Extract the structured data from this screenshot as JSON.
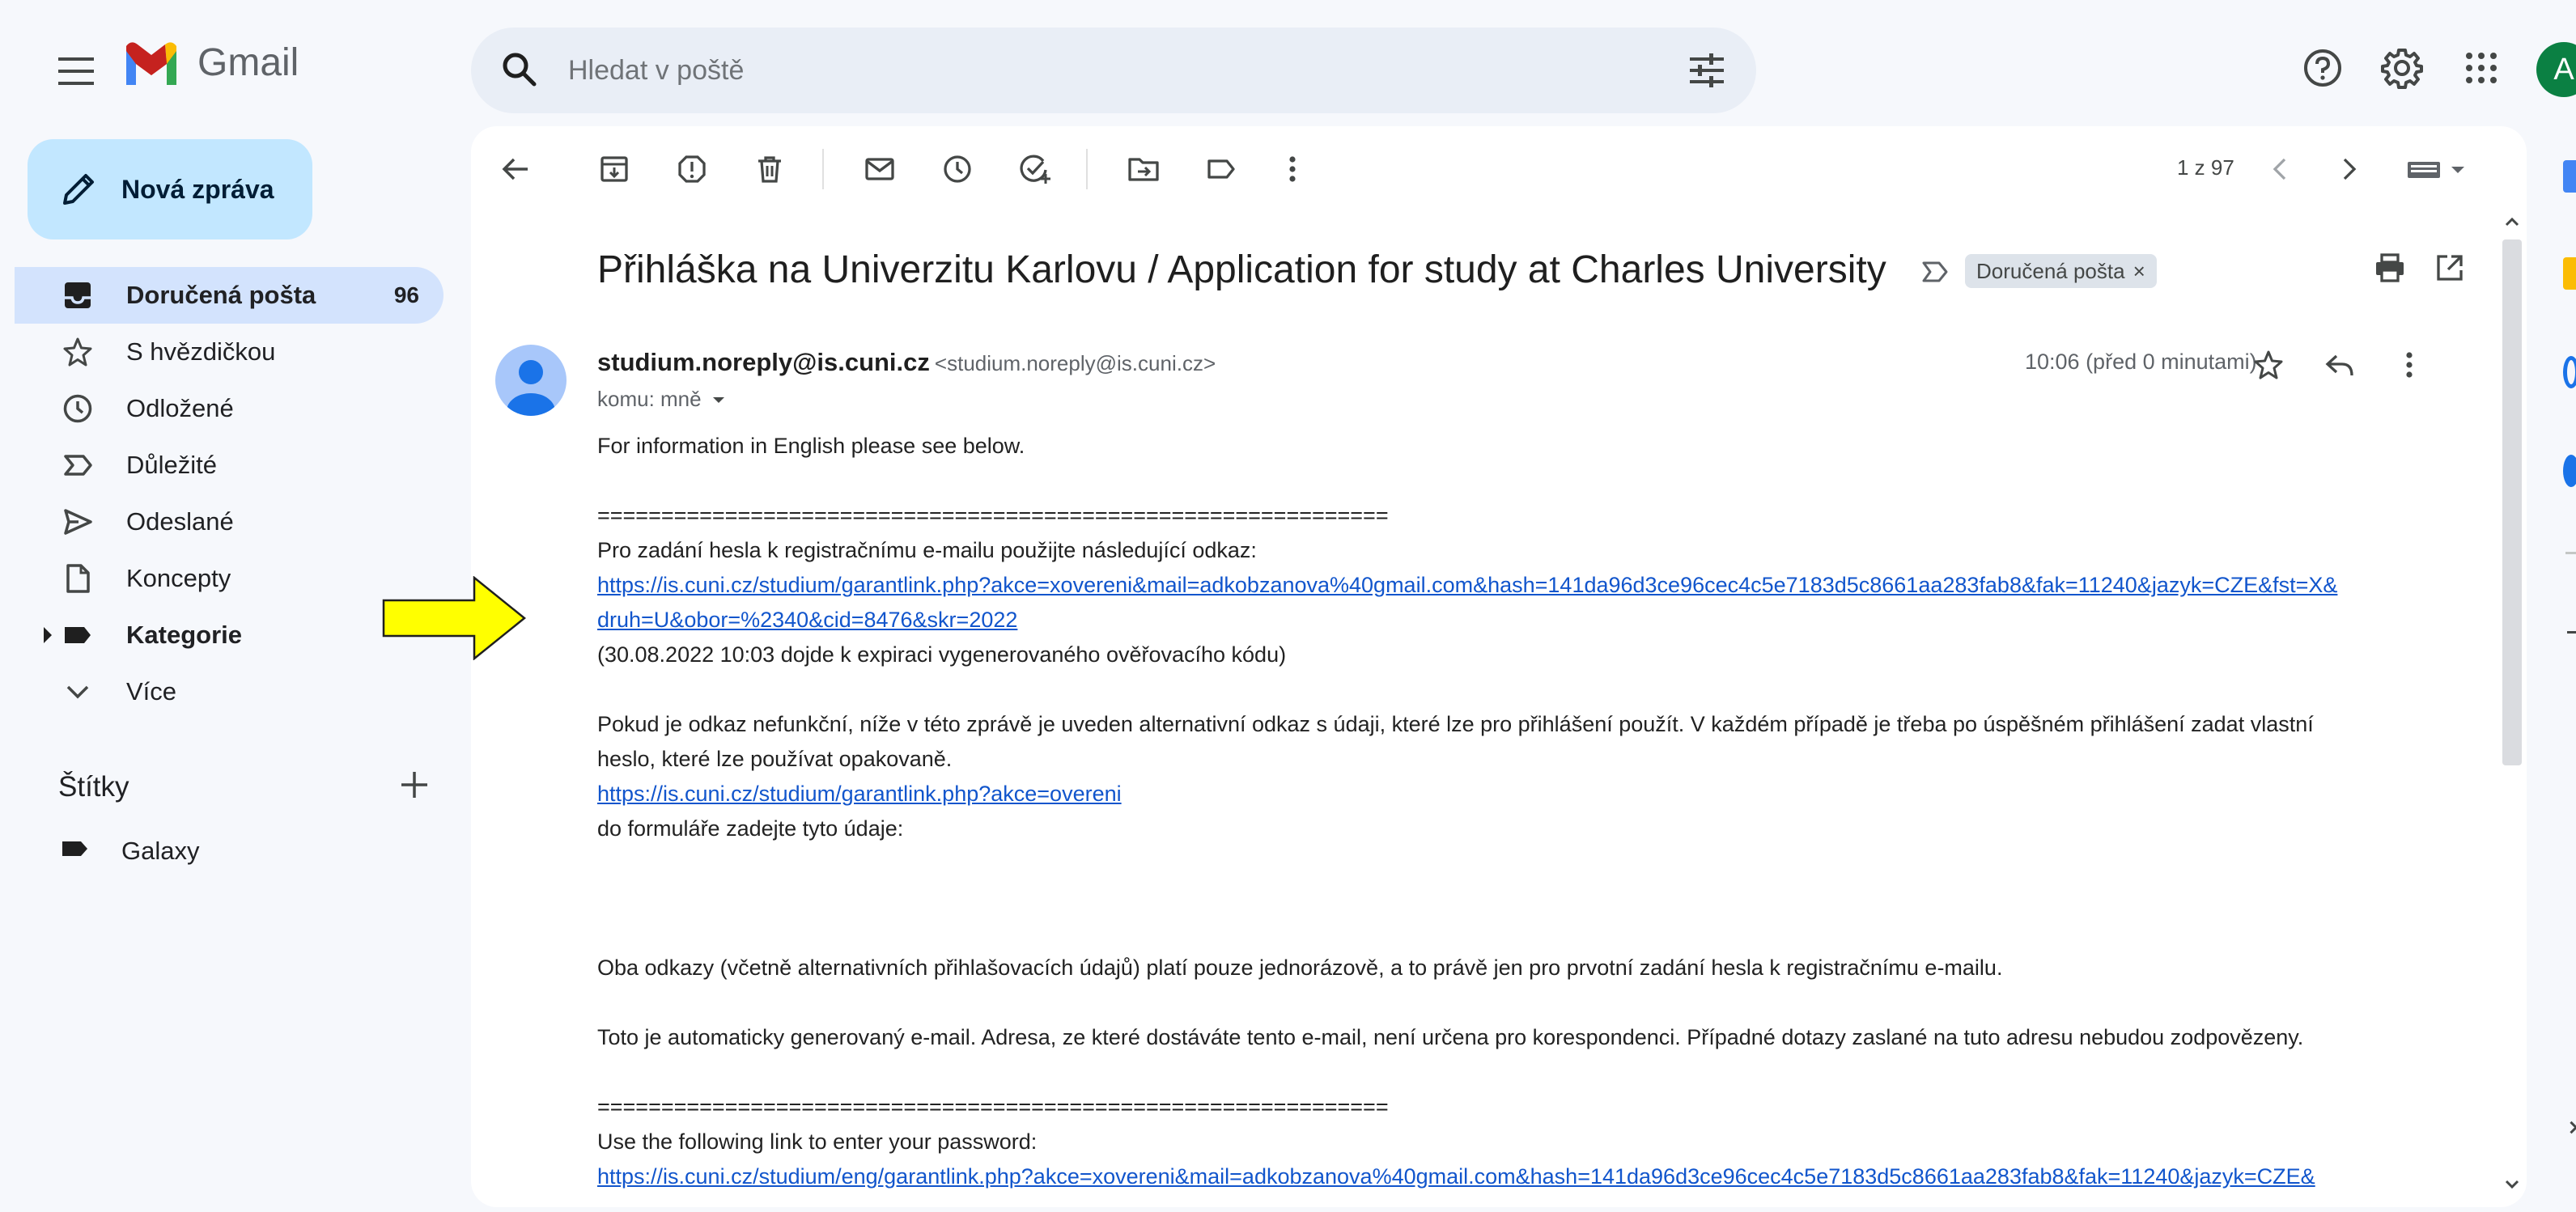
{
  "app": {
    "name": "Gmail"
  },
  "search": {
    "placeholder": "Hledat v poště"
  },
  "account": {
    "initial": "A"
  },
  "compose": {
    "label": "Nová zpráva"
  },
  "nav": {
    "items": [
      {
        "label": "Doručená pošta",
        "count": "96",
        "icon": "inbox-icon"
      },
      {
        "label": "S hvězdičkou",
        "icon": "star-icon"
      },
      {
        "label": "Odložené",
        "icon": "clock-icon"
      },
      {
        "label": "Důležité",
        "icon": "important-icon"
      },
      {
        "label": "Odeslané",
        "icon": "send-icon"
      },
      {
        "label": "Koncepty",
        "icon": "draft-icon"
      },
      {
        "label": "Kategorie",
        "icon": "label-icon"
      },
      {
        "label": "Více",
        "icon": "chevron-down-icon"
      }
    ]
  },
  "labels": {
    "title": "Štítky",
    "items": [
      {
        "label": "Galaxy"
      }
    ]
  },
  "toolbar": {
    "pager": "1 z 97"
  },
  "message": {
    "subject": "Přihláška na Univerzitu Karlovu / Application for study at Charles University",
    "chip": "Doručená pošta",
    "chip_close": "×",
    "from_name": "studium.noreply@is.cuni.cz",
    "from_addr": "<studium.noreply@is.cuni.cz>",
    "to": "komu: mně",
    "time": "10:06 (před 0 minutami)",
    "body": {
      "intro": "For information in English please see below.",
      "separator": "==============================================================",
      "cz_link_intro": "Pro zadání hesla k registračnímu e-mailu použijte následující odkaz:",
      "cz_link_line1": "https://is.cuni.cz/studium/garantlink.php?akce=xovereni&mail=adkobzanova%40gmail.com&hash=141da96d3ce96cec4c5e7183d5c8661aa283fab8&fak=11240&jazyk=CZE&fst=X&",
      "cz_link_line2": "druh=U&obor=%2340&cid=8476&skr=2022",
      "cz_expiry": "(30.08.2022 10:03 dojde k expiraci vygenerovaného ověřovacího kódu)",
      "cz_alt_line1": "Pokud je odkaz nefunkční, níže v této zprávě je uveden alternativní odkaz s údaji, které lze pro přihlášení použít. V každém případě je třeba po úspěšném přihlášení zadat vlastní",
      "cz_alt_line2": "heslo, které lze používat opakovaně.",
      "cz_alt_link": "https://is.cuni.cz/studium/garantlink.php?akce=overeni",
      "cz_form": "do formuláře zadejte tyto údaje:",
      "cz_once": "Oba odkazy (včetně alternativních přihlašovacích údajů) platí pouze jednorázově, a to právě jen pro prvotní zadání hesla k registračnímu e-mailu.",
      "cz_auto": "Toto je automaticky generovaný e-mail. Adresa, ze které dostáváte tento e-mail, není určena pro korespondenci. Případné dotazy zaslané na tuto adresu nebudou zodpovězeny.",
      "separator2": "==============================================================",
      "en_link_intro": "Use the following link to enter your password:",
      "en_link_line1": "https://is.cuni.cz/studium/eng/garantlink.php?akce=xovereni&mail=adkobzanova%40gmail.com&hash=141da96d3ce96cec4c5e7183d5c8661aa283fab8&fak=11240&jazyk=CZE&"
    }
  },
  "colors": {
    "accent": "#0b57d0",
    "link": "#1155cc",
    "arrow": "#ffff00"
  }
}
